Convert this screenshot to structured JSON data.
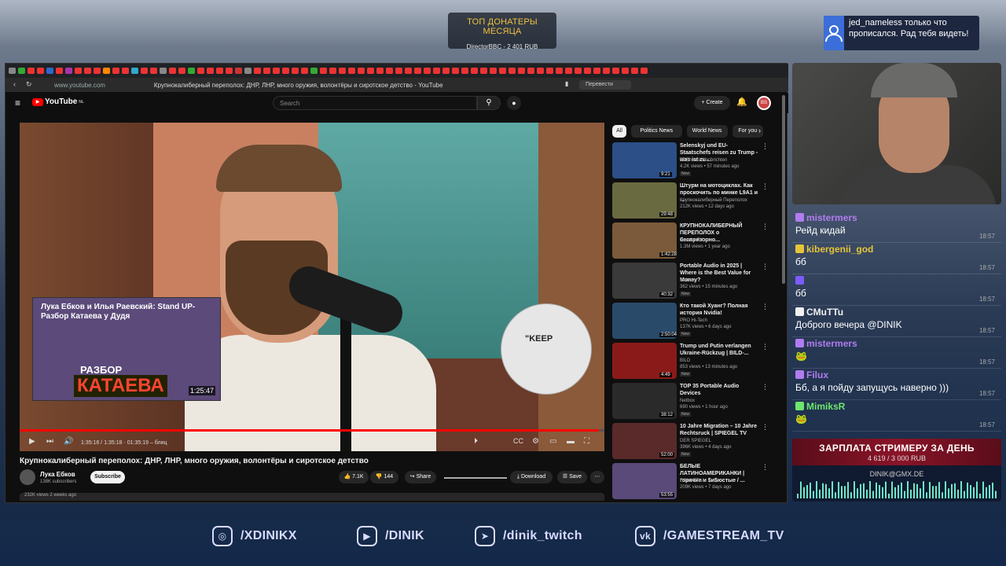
{
  "overlay": {
    "donors": {
      "title": "ТОП ДОНАТЕРЫ МЕСЯЦА",
      "top": "DirectorBBC - 2 401 RUB"
    },
    "notification": {
      "text": "jed_nameless только что прописался. Рад тебя видеть!"
    },
    "salary": {
      "title": "ЗАРПЛАТА СТРИМЕРУ ЗА ДЕНЬ",
      "amount": "4 619 / 3 000 RUB",
      "email": "DINIK@GMX.DE",
      "progress": 1.54
    },
    "socials": [
      {
        "icon": "instagram-icon",
        "label": "/XDINIKX"
      },
      {
        "icon": "youtube-icon",
        "label": "/DINIK"
      },
      {
        "icon": "telegram-icon",
        "label": "/dinik_twitch"
      },
      {
        "icon": "vk-icon",
        "label": "/GAMESTREAM_TV"
      }
    ]
  },
  "browser": {
    "url": "www.youtube.com",
    "title": "Крупнокалиберный переполох: ДНР, ЛНР, много оружия, волонтёры и сиротское детство - YouTube",
    "translate_label": "Перевести"
  },
  "youtube": {
    "logo": "YouTube",
    "logo_suffix": "NL",
    "search_placeholder": "Search",
    "create_label": "Create",
    "account_initials": "BS",
    "video": {
      "time": "1:35:16 / 1:35:18 · 01:35:19 – блиц",
      "progress": 0.99,
      "pip_title": "Лука Ебков и Илья Раевский: Stand UP- Разбор Катаева у Дудя",
      "pip_big1": "РАЗБОР",
      "pip_big2": "КАТАЕВА",
      "pip_duration": "1:25:47",
      "circle_text": "\"KEEP"
    },
    "video_title": "Крупнокалиберный переполох: ДНР, ЛНР, много оружия, волонтёры и сиротское детство",
    "channel": {
      "name": "Лука Ебков",
      "subs": "138K subscribers",
      "subscribe": "Subscribe"
    },
    "actions": {
      "likes": "7.1K",
      "dislikes": "144",
      "share": "Share",
      "download": "Download",
      "save": "Save"
    },
    "description_meta": "232K views  2 weeks ago",
    "chips": [
      "All",
      "Politics News",
      "World News",
      "For you"
    ],
    "recommendations": [
      {
        "title": "Selenskyj und EU-Staatschefs reisen zu Trump - was ist zu ...",
        "channel": "ZDFheute Nachrichten",
        "meta": "4.2K views • 57 minutes ago",
        "badge": "New",
        "duration": "9:21",
        "thumb": "#2b4f86"
      },
      {
        "title": "Штурм на мотоциклах. Как проскочить по минке  L9A1 и ...",
        "channel": "Крупнокалиберный Переполох",
        "meta": "212K views • 12 days ago",
        "badge": "",
        "duration": "29:48",
        "thumb": "#6a6a40"
      },
      {
        "title": "КРУПНОКАЛИБЕРНЫЙ ПЕРЕПОЛОХ о беспризорно...",
        "channel": "Tatarka FM",
        "meta": "1.3M views • 1 year ago",
        "badge": "",
        "duration": "1:42:28",
        "thumb": "#7a5a3a"
      },
      {
        "title": "Portable Audio in 2025 | Where is the Best Value for Money?",
        "channel": "Netbox",
        "meta": "362 views • 15 minutes ago",
        "badge": "New",
        "duration": "40:32",
        "thumb": "#3a3a3a"
      },
      {
        "title": "Кто такой Хуанг? Полная история Nvidia!",
        "channel": "PRO Hi-Tech",
        "meta": "137K views • 6 days ago",
        "badge": "New",
        "duration": "2:50:04",
        "thumb": "#2a4a6a"
      },
      {
        "title": "Trump und Putin verlangen Ukraine-Rückzug | BILD-...",
        "channel": "BILD",
        "meta": "853 views • 13 minutes ago",
        "badge": "New",
        "duration": "4:49",
        "thumb": "#8a1a1a"
      },
      {
        "title": "TOP 35 Portable Audio Devices",
        "channel": "Netbox",
        "meta": "690 views • 1 hour ago",
        "badge": "New",
        "duration": "38:12",
        "thumb": "#2a2a2a"
      },
      {
        "title": "10 Jahre Migration – 10 Jahre Rechtsruck | SPIEGEL TV",
        "channel": "DER SPIEGEL",
        "meta": "396K views • 4 days ago",
        "badge": "New",
        "duration": "52:00",
        "thumb": "#5a2a2a"
      },
      {
        "title": "БЕЛЫЕ ЛАТИНОАМЕРИКАНКИ | горячие и $и$юстые / ...",
        "channel": "ПЛАНЕТКА",
        "meta": "209K views • 7 days ago",
        "badge": "",
        "duration": "53:55",
        "thumb": "#5a4a7a"
      }
    ]
  },
  "chat": [
    {
      "user": "mistermers",
      "color": "#b07cf0",
      "text": "Рейд кидай",
      "time": "18:57"
    },
    {
      "user": "kibergenii_god",
      "color": "#e6c43a",
      "text": "бб",
      "time": "18:57"
    },
    {
      "user": "",
      "color": "#7c5cff",
      "text": "бб",
      "time": "18:57"
    },
    {
      "user": "CMuTTu",
      "color": "#f0f0f0",
      "text": "Доброго вечера @DINIK",
      "time": "18:57"
    },
    {
      "user": "mistermers",
      "color": "#b07cf0",
      "text": "",
      "time": "18:57"
    },
    {
      "user": "Filux",
      "color": "#b07cf0",
      "text": "Бб, а я пойду запущусь наверно )))",
      "time": "18:57"
    },
    {
      "user": "MimiksR",
      "color": "#6ee66e",
      "text": "",
      "time": "18:57"
    }
  ]
}
